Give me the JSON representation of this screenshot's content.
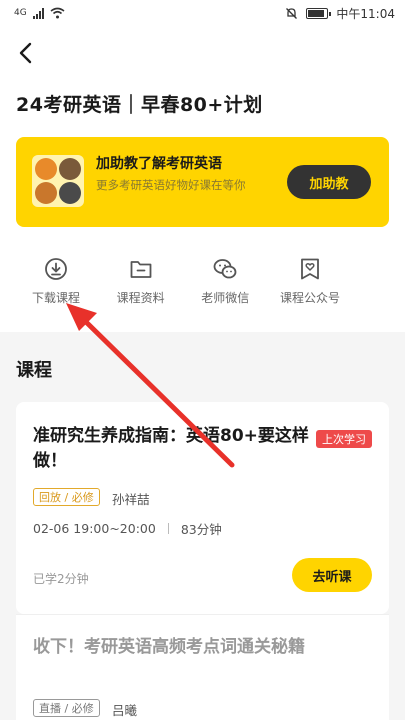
{
  "status_bar": {
    "carrier": "4G",
    "time": "中午11:04"
  },
  "page_title": "24考研英语｜早春80+计划",
  "banner": {
    "title": "加助教了解考研英语",
    "subtitle": "更多考研英语好物好课在等你",
    "button_label": "加助教"
  },
  "quick_tools": [
    {
      "label": "下载课程",
      "icon": "download-icon"
    },
    {
      "label": "课程资料",
      "icon": "folder-icon"
    },
    {
      "label": "老师微信",
      "icon": "wechat-icon"
    },
    {
      "label": "课程公众号",
      "icon": "bookmark-heart-icon"
    }
  ],
  "section_title": "课程",
  "courses": [
    {
      "title": "准研究生养成指南：英语80+要这样做！",
      "badge": "上次学习",
      "tag": "回放 / 必修",
      "teacher": "孙祥喆",
      "time": "02-06 19:00~20:00",
      "duration": "83分钟",
      "progress": "已学2分钟",
      "button_label": "去听课"
    },
    {
      "title": "收下！考研英语高频考点词通关秘籍",
      "tag": "直播 / 必修",
      "teacher": "吕曦"
    }
  ],
  "colors": {
    "accent_yellow": "#ffd400",
    "badge_red": "#ee4a4a",
    "annotation_red": "#e8312a"
  }
}
